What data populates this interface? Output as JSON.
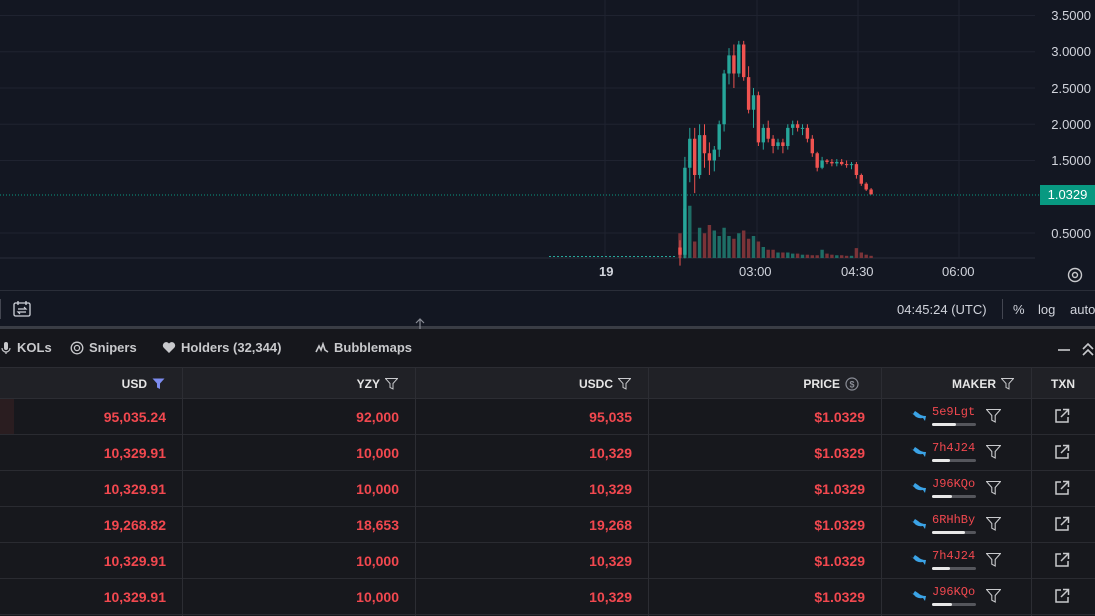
{
  "chart": {
    "price_axis": [
      "3.5000",
      "3.0000",
      "2.5000",
      "2.0000",
      "1.5000",
      "0.5000"
    ],
    "current_price": "1.0329",
    "time_axis": [
      "19",
      "03:00",
      "04:30",
      "06:00"
    ],
    "colors": {
      "up": "#26a69a",
      "down": "#ef5350",
      "up_volume": "#1e6e66",
      "down_volume": "#7a3338",
      "last_price_tag": "#089981"
    },
    "candles": [
      {
        "o": 0.3,
        "h": 0.4,
        "l": 0.05,
        "c": 0.2
      },
      {
        "o": 0.2,
        "h": 1.55,
        "l": 0.15,
        "c": 1.4
      },
      {
        "o": 1.4,
        "h": 1.95,
        "l": 1.2,
        "c": 1.8
      },
      {
        "o": 1.8,
        "h": 1.95,
        "l": 1.05,
        "c": 1.3
      },
      {
        "o": 1.3,
        "h": 2.0,
        "l": 1.25,
        "c": 1.85
      },
      {
        "o": 1.85,
        "h": 2.0,
        "l": 1.4,
        "c": 1.6
      },
      {
        "o": 1.6,
        "h": 1.75,
        "l": 1.3,
        "c": 1.5
      },
      {
        "o": 1.5,
        "h": 1.7,
        "l": 1.35,
        "c": 1.65
      },
      {
        "o": 1.65,
        "h": 2.05,
        "l": 1.55,
        "c": 2.0
      },
      {
        "o": 2.0,
        "h": 2.75,
        "l": 1.9,
        "c": 2.7
      },
      {
        "o": 2.7,
        "h": 3.05,
        "l": 2.55,
        "c": 2.95
      },
      {
        "o": 2.95,
        "h": 3.1,
        "l": 2.5,
        "c": 2.7
      },
      {
        "o": 2.7,
        "h": 3.15,
        "l": 2.65,
        "c": 3.1
      },
      {
        "o": 3.1,
        "h": 3.15,
        "l": 2.6,
        "c": 2.65
      },
      {
        "o": 2.65,
        "h": 2.8,
        "l": 2.15,
        "c": 2.2
      },
      {
        "o": 2.2,
        "h": 2.5,
        "l": 1.95,
        "c": 2.4
      },
      {
        "o": 2.4,
        "h": 2.45,
        "l": 1.7,
        "c": 1.75
      },
      {
        "o": 1.75,
        "h": 2.0,
        "l": 1.65,
        "c": 1.95
      },
      {
        "o": 1.95,
        "h": 2.05,
        "l": 1.75,
        "c": 1.8
      },
      {
        "o": 1.8,
        "h": 1.85,
        "l": 1.6,
        "c": 1.7
      },
      {
        "o": 1.7,
        "h": 1.8,
        "l": 1.65,
        "c": 1.75
      },
      {
        "o": 1.75,
        "h": 1.8,
        "l": 1.6,
        "c": 1.7
      },
      {
        "o": 1.7,
        "h": 2.0,
        "l": 1.65,
        "c": 1.95
      },
      {
        "o": 1.95,
        "h": 2.05,
        "l": 1.85,
        "c": 2.0
      },
      {
        "o": 2.0,
        "h": 2.05,
        "l": 1.9,
        "c": 1.95
      },
      {
        "o": 1.95,
        "h": 2.0,
        "l": 1.85,
        "c": 1.95
      },
      {
        "o": 1.95,
        "h": 2.0,
        "l": 1.75,
        "c": 1.8
      },
      {
        "o": 1.8,
        "h": 1.85,
        "l": 1.55,
        "c": 1.6
      },
      {
        "o": 1.6,
        "h": 1.62,
        "l": 1.35,
        "c": 1.4
      },
      {
        "o": 1.4,
        "h": 1.55,
        "l": 1.38,
        "c": 1.5
      },
      {
        "o": 1.5,
        "h": 1.52,
        "l": 1.45,
        "c": 1.48
      },
      {
        "o": 1.48,
        "h": 1.52,
        "l": 1.42,
        "c": 1.46
      },
      {
        "o": 1.46,
        "h": 1.52,
        "l": 1.42,
        "c": 1.48
      },
      {
        "o": 1.48,
        "h": 1.52,
        "l": 1.43,
        "c": 1.45
      },
      {
        "o": 1.45,
        "h": 1.5,
        "l": 1.4,
        "c": 1.44
      },
      {
        "o": 1.44,
        "h": 1.48,
        "l": 1.38,
        "c": 1.45
      },
      {
        "o": 1.45,
        "h": 1.48,
        "l": 1.25,
        "c": 1.3
      },
      {
        "o": 1.3,
        "h": 1.32,
        "l": 1.15,
        "c": 1.18
      },
      {
        "o": 1.18,
        "h": 1.2,
        "l": 1.08,
        "c": 1.1
      },
      {
        "o": 1.1,
        "h": 1.12,
        "l": 1.03,
        "c": 1.0329
      }
    ],
    "volumes": [
      0.45,
      0.9,
      0.95,
      0.3,
      0.55,
      0.45,
      0.6,
      0.5,
      0.4,
      0.55,
      0.4,
      0.35,
      0.45,
      0.5,
      0.35,
      0.4,
      0.3,
      0.2,
      0.15,
      0.15,
      0.1,
      0.1,
      0.1,
      0.08,
      0.08,
      0.06,
      0.06,
      0.05,
      0.05,
      0.15,
      0.08,
      0.06,
      0.05,
      0.05,
      0.04,
      0.04,
      0.18,
      0.1,
      0.06,
      0.04
    ]
  },
  "toolbar": {
    "time": "04:45:24 (UTC)",
    "percent": "%",
    "log": "log",
    "auto": "auto"
  },
  "tabs": [
    {
      "label": "KOLs",
      "icon": "microphone-icon"
    },
    {
      "label": "Snipers",
      "icon": "target-icon"
    },
    {
      "label": "Holders (32,344)",
      "icon": "heart-icon"
    },
    {
      "label": "Bubblemaps",
      "icon": "bubblemaps-icon"
    }
  ],
  "table": {
    "headers": {
      "usd": "USD",
      "yzy": "YZY",
      "usdc": "USDC",
      "price": "PRICE",
      "maker": "MAKER",
      "txn": "TXN"
    },
    "rows": [
      {
        "usd": "95,035.24",
        "yzy": "92,000",
        "usdc": "95,035",
        "price": "$1.0329",
        "maker": "5e9Lgt",
        "maker_fill": 0.55,
        "highlight": true
      },
      {
        "usd": "10,329.91",
        "yzy": "10,000",
        "usdc": "10,329",
        "price": "$1.0329",
        "maker": "7h4J24",
        "maker_fill": 0.4,
        "highlight": false
      },
      {
        "usd": "10,329.91",
        "yzy": "10,000",
        "usdc": "10,329",
        "price": "$1.0329",
        "maker": "J96KQo",
        "maker_fill": 0.45,
        "highlight": false
      },
      {
        "usd": "19,268.82",
        "yzy": "18,653",
        "usdc": "19,268",
        "price": "$1.0329",
        "maker": "6RHhBy",
        "maker_fill": 0.75,
        "highlight": false
      },
      {
        "usd": "10,329.91",
        "yzy": "10,000",
        "usdc": "10,329",
        "price": "$1.0329",
        "maker": "7h4J24",
        "maker_fill": 0.4,
        "highlight": false
      },
      {
        "usd": "10,329.91",
        "yzy": "10,000",
        "usdc": "10,329",
        "price": "$1.0329",
        "maker": "J96KQo",
        "maker_fill": 0.45,
        "highlight": false
      }
    ]
  }
}
